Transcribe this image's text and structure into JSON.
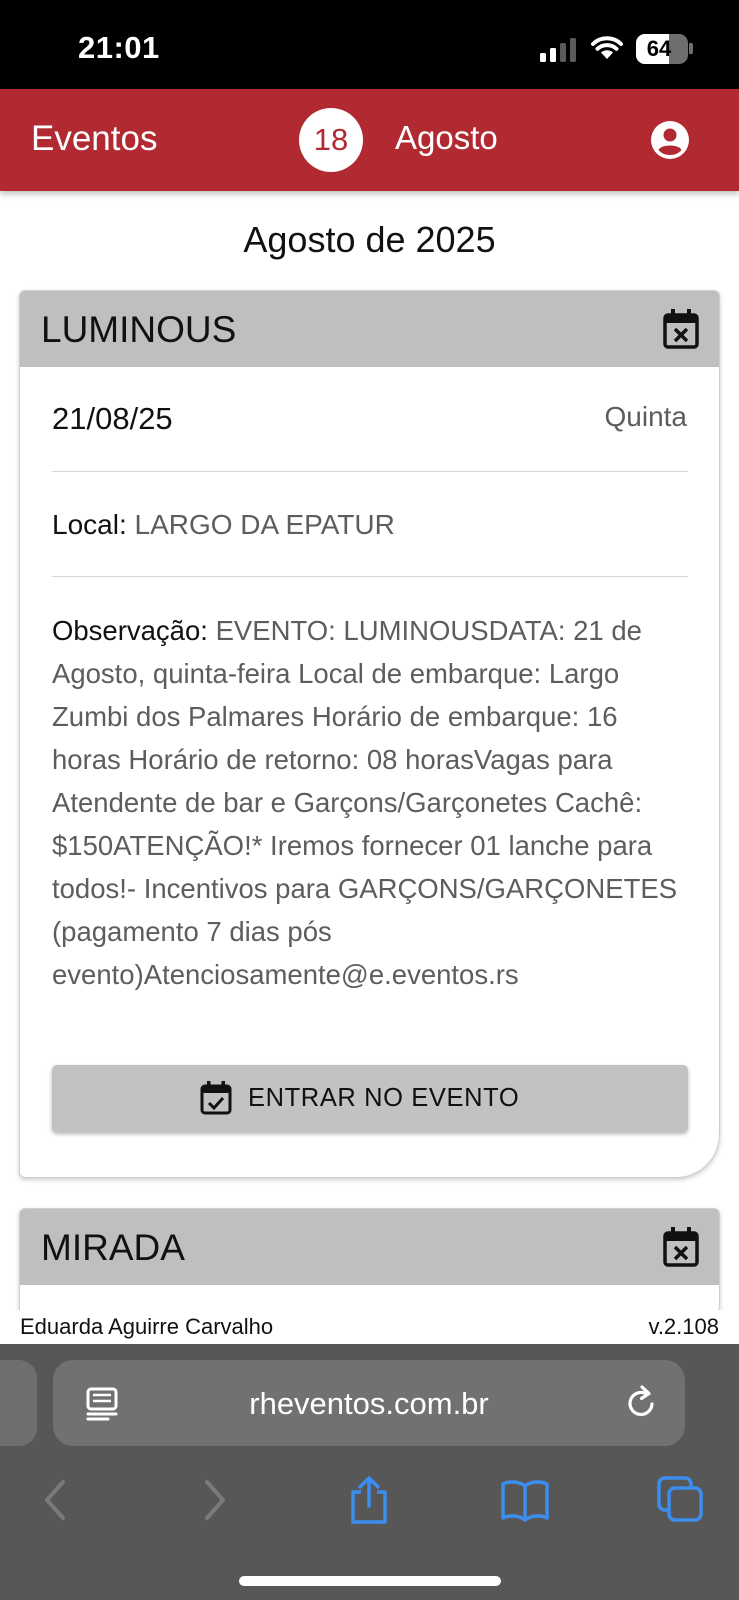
{
  "status_bar": {
    "time": "21:01",
    "battery": "64",
    "battery_level": 0.64
  },
  "app_bar": {
    "title": "Eventos",
    "day_badge": "18",
    "month": "Agosto",
    "account_icon": "account-circle-icon",
    "brand_color": "#b12a32"
  },
  "content": {
    "month_heading": "Agosto de 2025",
    "events": [
      {
        "name": "LUMINOUS",
        "header_icon": "calendar-remove-icon",
        "date": "21/08/25",
        "weekday": "Quinta",
        "local_label": "Local:",
        "local_value": "LARGO DA EPATUR",
        "obs_label": "Observação:",
        "obs_value": "EVENTO: LUMINOUSDATA: 21 de Agosto, quinta-feira Local de embarque: Largo Zumbi dos Palmares Horário de embarque: 16 horas Horário de retorno: 08 horasVagas para Atendente de bar e Garçons/Garçonetes Cachê: $150ATENÇÃO!* Iremos fornecer 01 lanche para todos!- Incentivos para GARÇONS/GARÇONETES (pagamento 7 dias pós evento)Atenciosamente@e.eventos.rs",
        "button_icon": "calendar-check-icon",
        "button_label": "ENTRAR NO EVENTO"
      },
      {
        "name": "MIRADA",
        "header_icon": "calendar-remove-icon"
      }
    ]
  },
  "footer": {
    "user": "Eduarda Aguirre Carvalho",
    "version": "v.2.108"
  },
  "browser": {
    "url": "rheventos.com.br",
    "icons": [
      "reader-icon",
      "reload-icon",
      "back-icon",
      "forward-icon",
      "share-icon",
      "bookmarks-icon",
      "tabs-icon"
    ],
    "accent": "#3b8ef0"
  }
}
